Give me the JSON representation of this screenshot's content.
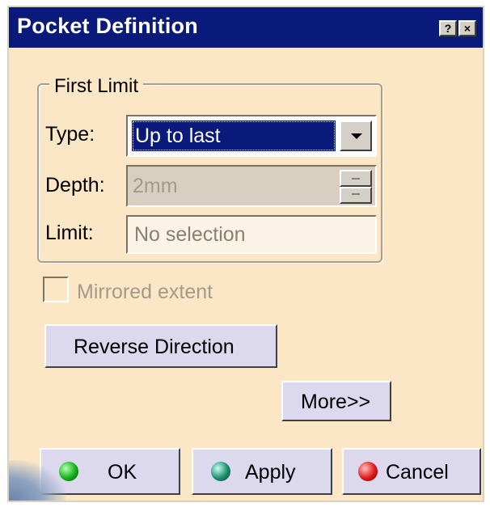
{
  "window": {
    "title": "Pocket Definition",
    "help_glyph": "?",
    "close_glyph": "×"
  },
  "first_limit": {
    "legend": "First Limit",
    "type_label": "Type:",
    "type_value": "Up to last",
    "depth_label": "Depth:",
    "depth_value": "2mm",
    "limit_label": "Limit:",
    "limit_value": "No selection"
  },
  "options": {
    "mirrored_label": "Mirrored extent",
    "mirrored_checked": false
  },
  "buttons": {
    "reverse_direction": "Reverse Direction",
    "more": "More>>",
    "ok": "OK",
    "apply": "Apply",
    "cancel": "Cancel"
  },
  "icons": {
    "ok": "green-ball-icon",
    "apply": "teal-ball-icon",
    "cancel": "red-ball-icon"
  },
  "colors": {
    "titlebar": "#0a1a7a",
    "dialog_bg": "#fbe7c5",
    "button_bg": "#dcd8ee",
    "disabled_text": "#a49a8a"
  }
}
